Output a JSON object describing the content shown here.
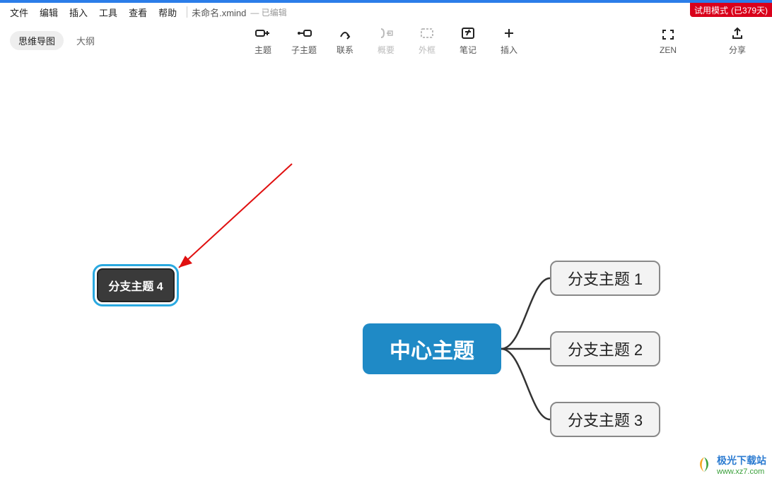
{
  "menu": {
    "items": [
      "文件",
      "编辑",
      "插入",
      "工具",
      "查看",
      "帮助"
    ],
    "doc_title": "未命名.xmind",
    "doc_status": "— 已编辑"
  },
  "trial": {
    "label": "试用模式",
    "days": "(已379天)"
  },
  "viewtabs": {
    "mindmap": "思维导图",
    "outline": "大纲"
  },
  "toolbar": {
    "topic": "主题",
    "subtopic": "子主题",
    "relation": "联系",
    "summary": "概要",
    "boundary": "外框",
    "note": "笔记",
    "insert": "插入",
    "zen": "ZEN",
    "share": "分享"
  },
  "mindmap": {
    "center": "中心主题",
    "branch1": "分支主题 1",
    "branch2": "分支主题 2",
    "branch3": "分支主题 3",
    "floating": "分支主题 4"
  },
  "watermark": {
    "text": "极光下载站",
    "url": "www.xz7.com"
  }
}
